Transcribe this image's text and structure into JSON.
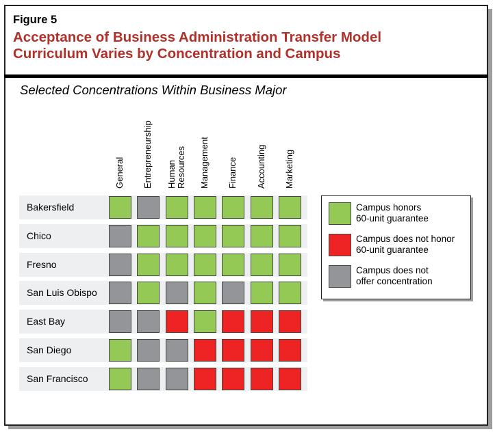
{
  "figure_label": "Figure 5",
  "title_lines": [
    "Acceptance of Business Administration Transfer Model",
    "Curriculum Varies by Concentration and Campus"
  ],
  "subtitle": "Selected Concentrations Within Business Major",
  "colors": {
    "honors": "#93c954",
    "not_honor": "#ee2424",
    "not_offered": "#939598",
    "title": "#b0302a",
    "row_band": "#eeeff0"
  },
  "chart_data": {
    "type": "table",
    "title": "Acceptance of Business Administration Transfer Model Curriculum Varies by Concentration and Campus",
    "subtitle": "Selected Concentrations Within Business Major",
    "columns": [
      {
        "label": "General",
        "lines": [
          "General"
        ]
      },
      {
        "label": "Entrepreneurship",
        "lines": [
          "Entrepreneurship"
        ]
      },
      {
        "label": "Human Resources",
        "lines": [
          "Human",
          "Resources"
        ]
      },
      {
        "label": "Management",
        "lines": [
          "Management"
        ]
      },
      {
        "label": "Finance",
        "lines": [
          "Finance"
        ]
      },
      {
        "label": "Accounting",
        "lines": [
          "Accounting"
        ]
      },
      {
        "label": "Marketing",
        "lines": [
          "Marketing"
        ]
      }
    ],
    "rows": [
      {
        "campus": "Bakersfield",
        "values": [
          "honors",
          "not_offered",
          "honors",
          "honors",
          "honors",
          "honors",
          "honors"
        ]
      },
      {
        "campus": "Chico",
        "values": [
          "not_offered",
          "honors",
          "honors",
          "honors",
          "honors",
          "honors",
          "honors"
        ]
      },
      {
        "campus": "Fresno",
        "values": [
          "not_offered",
          "honors",
          "honors",
          "honors",
          "honors",
          "honors",
          "honors"
        ]
      },
      {
        "campus": "San Luis Obispo",
        "values": [
          "not_offered",
          "honors",
          "not_offered",
          "honors",
          "not_offered",
          "honors",
          "honors"
        ]
      },
      {
        "campus": "East Bay",
        "values": [
          "not_offered",
          "not_offered",
          "not_honor",
          "honors",
          "not_honor",
          "not_honor",
          "not_honor"
        ]
      },
      {
        "campus": "San Diego",
        "values": [
          "honors",
          "not_offered",
          "not_offered",
          "not_honor",
          "not_honor",
          "not_honor",
          "not_honor"
        ]
      },
      {
        "campus": "San Francisco",
        "values": [
          "honors",
          "not_offered",
          "not_offered",
          "not_honor",
          "not_honor",
          "not_honor",
          "not_honor"
        ]
      }
    ],
    "legend": [
      {
        "key": "honors",
        "text": "Campus honors\n60-unit guarantee"
      },
      {
        "key": "not_honor",
        "text": "Campus does not honor\n60-unit guarantee"
      },
      {
        "key": "not_offered",
        "text": "Campus does not\noffer concentration"
      }
    ],
    "legend_position": "right"
  }
}
